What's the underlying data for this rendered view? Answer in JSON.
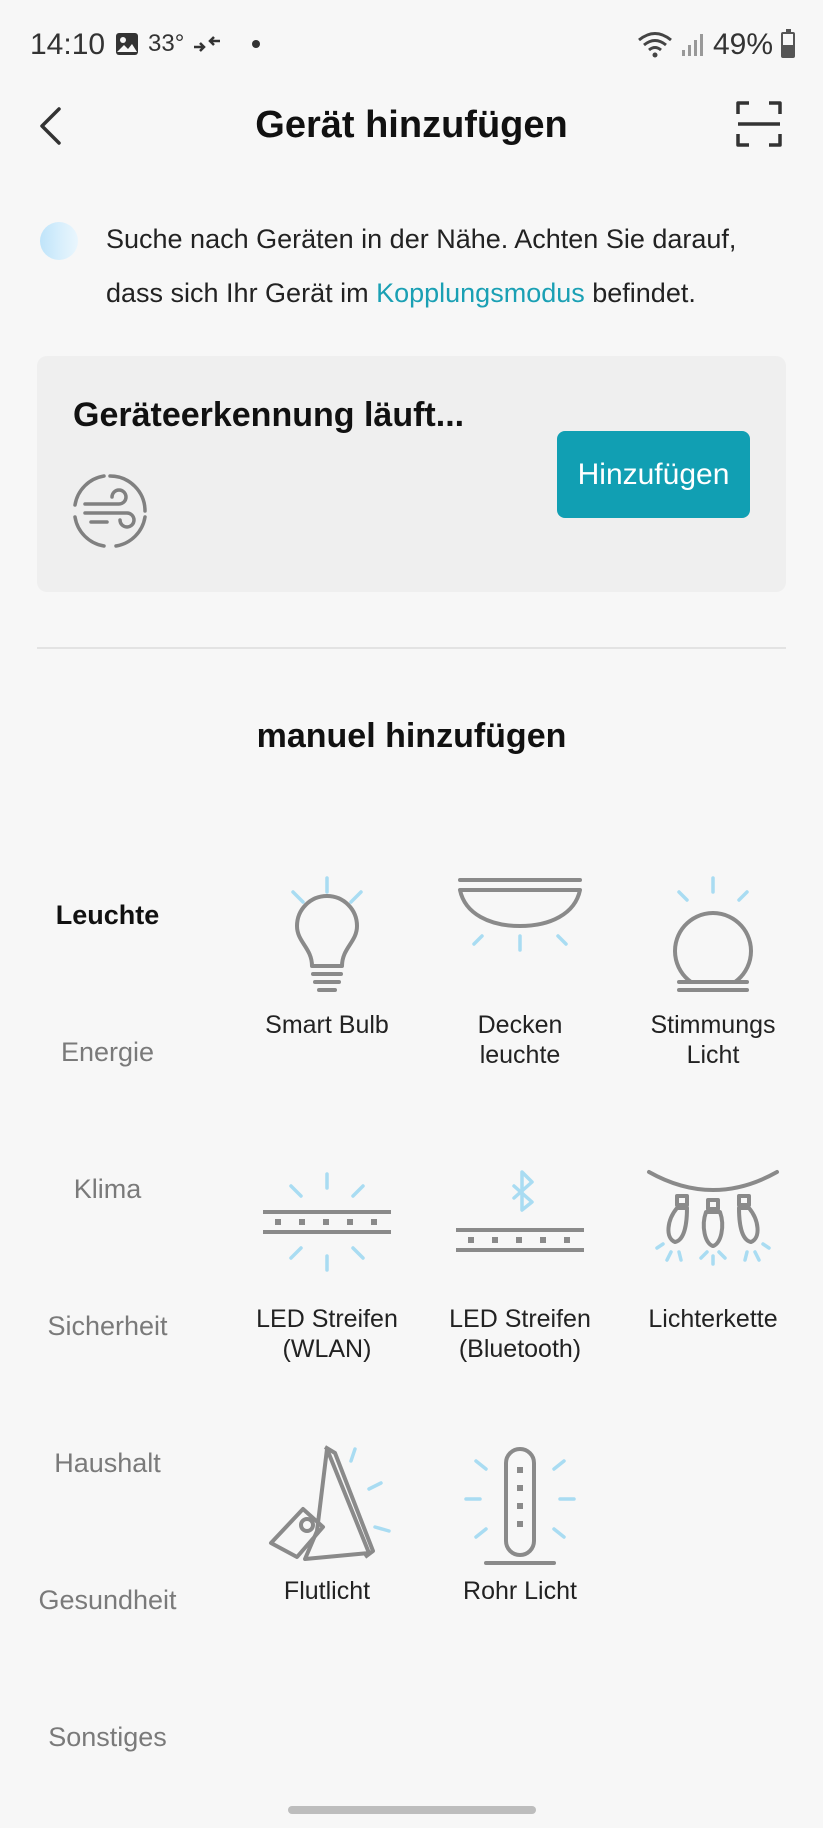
{
  "status_bar": {
    "time": "14:10",
    "temperature": "33°",
    "battery": "49%",
    "icons": [
      "gallery-icon",
      "data-transfer-icon",
      "wifi-icon",
      "signal-icon",
      "battery-icon"
    ]
  },
  "header": {
    "title": "Gerät hinzufügen",
    "back_icon": "chevron-left-icon",
    "scan_icon": "scan-icon"
  },
  "info": {
    "text_before": "Suche nach Geräten in der Nähe. Achten Sie darauf, dass sich Ihr Gerät im ",
    "link": "Kopplungsmodus",
    "text_after": " befindet."
  },
  "detection": {
    "title": "Geräteerkennung läuft...",
    "button_label": "Hinzufügen",
    "icon": "scanning-wind-icon"
  },
  "manual": {
    "title": "manuel hinzufügen"
  },
  "categories": [
    {
      "label": "Leuchte",
      "active": true
    },
    {
      "label": "Energie",
      "active": false
    },
    {
      "label": "Klima",
      "active": false
    },
    {
      "label": "Sicherheit",
      "active": false
    },
    {
      "label": "Haushalt",
      "active": false
    },
    {
      "label": "Gesundheit",
      "active": false
    },
    {
      "label": "Sonstiges",
      "active": false
    }
  ],
  "devices": [
    {
      "label": "Smart Bulb",
      "icon": "smart-bulb-icon"
    },
    {
      "label": "Decken\nleuchte",
      "icon": "ceiling-light-icon"
    },
    {
      "label": "Stimmungs\nLicht",
      "icon": "mood-light-icon"
    },
    {
      "label": "LED Streifen\n(WLAN)",
      "icon": "led-strip-wifi-icon"
    },
    {
      "label": "LED Streifen\n(Bluetooth)",
      "icon": "led-strip-bluetooth-icon"
    },
    {
      "label": "Lichterkette",
      "icon": "string-lights-icon"
    },
    {
      "label": "Flutlicht",
      "icon": "floodlight-icon"
    },
    {
      "label": "Rohr Licht",
      "icon": "tube-light-icon"
    }
  ],
  "colors": {
    "accent": "#119fb3",
    "link": "#1aa0b4",
    "icon_gray": "#8a8a8a",
    "icon_blue": "#a9dcf2"
  }
}
